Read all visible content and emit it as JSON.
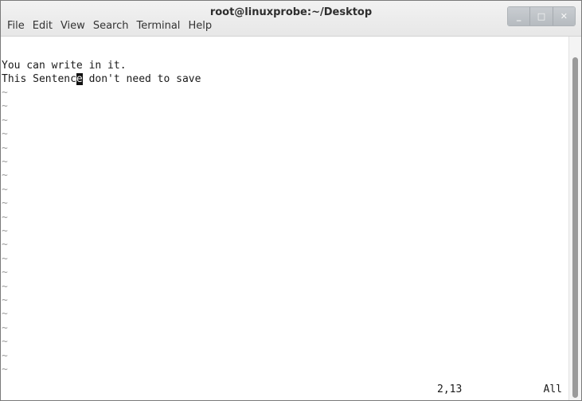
{
  "window": {
    "title": "root@linuxprobe:~/Desktop",
    "controls": {
      "minimize": "_",
      "maximize": "□",
      "close": "✕"
    }
  },
  "menubar": {
    "items": [
      "File",
      "Edit",
      "View",
      "Search",
      "Terminal",
      "Help"
    ]
  },
  "editor": {
    "line1": "You can write in it.",
    "line2_before_cursor": "This Sentenc",
    "line2_cursor_char": "e",
    "line2_after_cursor": " don't need to save",
    "tilde": "~",
    "tilde_count": 21,
    "status_position": "2,13",
    "status_scroll": "All"
  },
  "colors": {
    "background": "#ffffff",
    "text": "#1a1a1a",
    "cursor": "#111111",
    "tilde": "#9c9c9c"
  }
}
